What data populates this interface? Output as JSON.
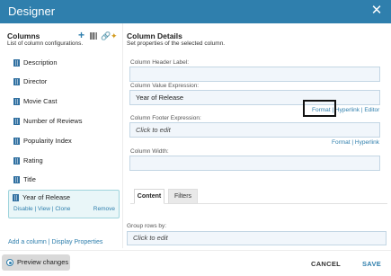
{
  "window": {
    "title": "Designer",
    "close_icon": "close-icon"
  },
  "columns_panel": {
    "heading": "Columns",
    "subheading": "List of column configurations.",
    "toolbar_icons": [
      "plus-icon",
      "columns-icon",
      "link-icon",
      "wand-icon"
    ],
    "items": [
      {
        "label": "Description"
      },
      {
        "label": "Director"
      },
      {
        "label": "Movie Cast"
      },
      {
        "label": "Number of Reviews"
      },
      {
        "label": "Popularity Index"
      },
      {
        "label": "Rating"
      },
      {
        "label": "Title"
      }
    ],
    "selected": {
      "label": "Year of Release",
      "disable": "Disable",
      "sep": "|",
      "view": "View",
      "clone": "Clone",
      "remove": "Remove"
    },
    "add_column": "Add a column",
    "sep": "|",
    "display_properties": "Display Properties"
  },
  "details_panel": {
    "heading": "Column Details",
    "subheading": "Set properties of the selected column.",
    "header_label": {
      "label": "Column Header Label:",
      "value": ""
    },
    "value_expression": {
      "label": "Column Value Expression:",
      "value": "Year of Release",
      "format": "Format",
      "sep": "|",
      "hyperlink": "Hyperlink",
      "editor": "Editor"
    },
    "footer_expression": {
      "label": "Column Footer Expression:",
      "placeholder": "Click to edit",
      "format": "Format",
      "sep": "|",
      "hyperlink": "Hyperlink"
    },
    "width": {
      "label": "Column Width:",
      "value": ""
    },
    "tabs": [
      {
        "label": "Content"
      },
      {
        "label": "Filters"
      }
    ],
    "group_rows": {
      "label": "Group rows by:",
      "placeholder": "Click to edit"
    }
  },
  "footer": {
    "preview_label": "Preview changes",
    "cancel_label": "CANCEL",
    "save_label": "SAVE"
  },
  "colors": {
    "titlebar": "#2f7fad",
    "link": "#2f7fad",
    "selected_bg": "#e9f6f8",
    "field_bg": "#f1f6fb"
  }
}
